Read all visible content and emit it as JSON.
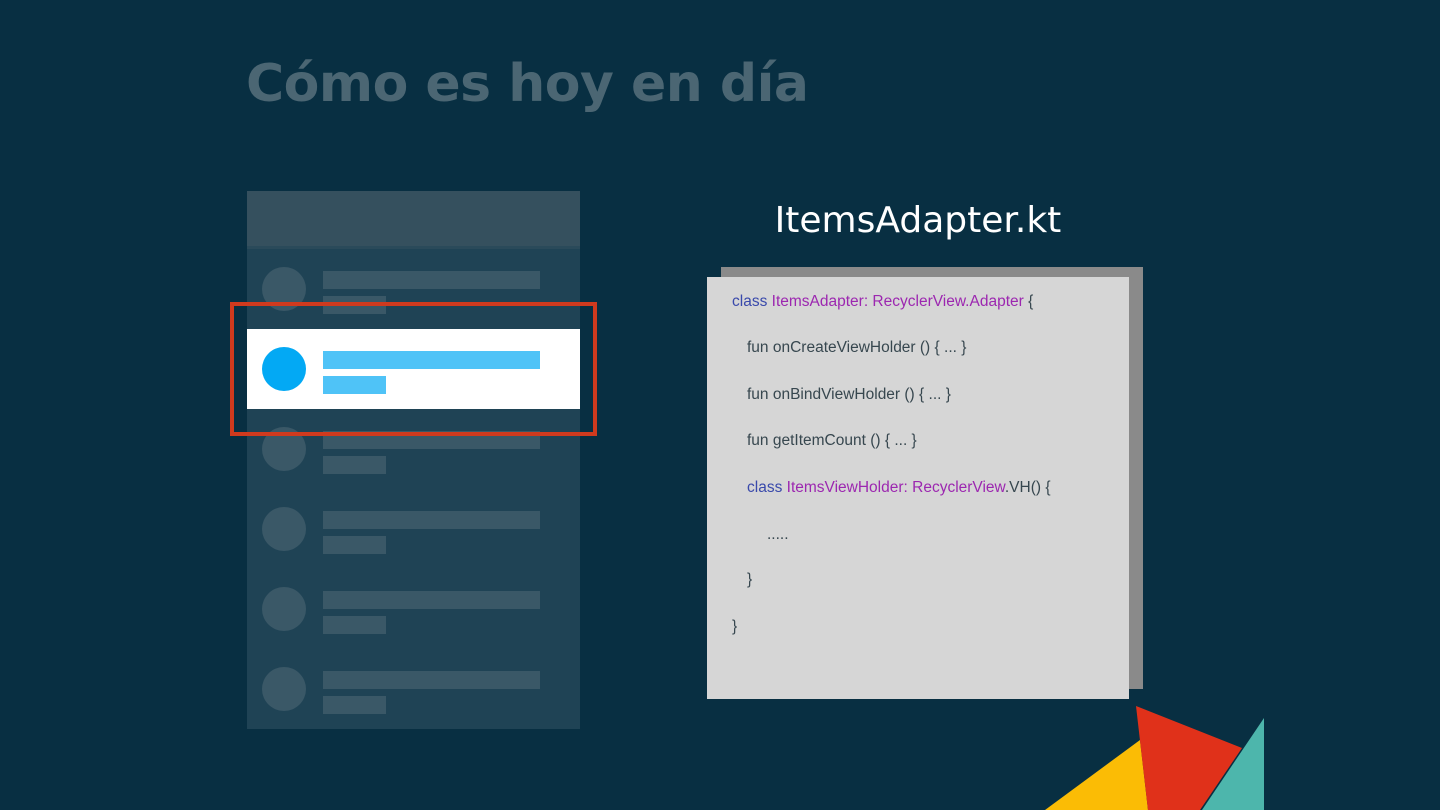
{
  "slide": {
    "title": "Cómo es hoy en día"
  },
  "list_mockup": {
    "rows": 6,
    "active_row_index": 1
  },
  "code_panel": {
    "filename": "ItemsAdapter.kt",
    "lines": {
      "l1": {
        "kw": "class",
        "type": "ItemsAdapter: RecyclerView.Adapter",
        "rest": " {"
      },
      "l2": "fun onCreateViewHolder () { ... }",
      "l3": "fun onBindViewHolder () { ... }",
      "l4": "fun getItemCount () { ... }",
      "l5": {
        "kw": "class",
        "type": "ItemsViewHolder: RecyclerView",
        "rest": ".VH() {"
      },
      "l6": ".....",
      "l7": "}",
      "l8": "}"
    }
  },
  "colors": {
    "background": "#082f42",
    "highlight": "#d03a1e",
    "accent_blue": "#03a9f4",
    "keyword": "#3949ab",
    "type": "#9c27b0",
    "deco_yellow": "#fbbc05",
    "deco_red": "#e0311a",
    "deco_teal": "#4db6ac"
  }
}
